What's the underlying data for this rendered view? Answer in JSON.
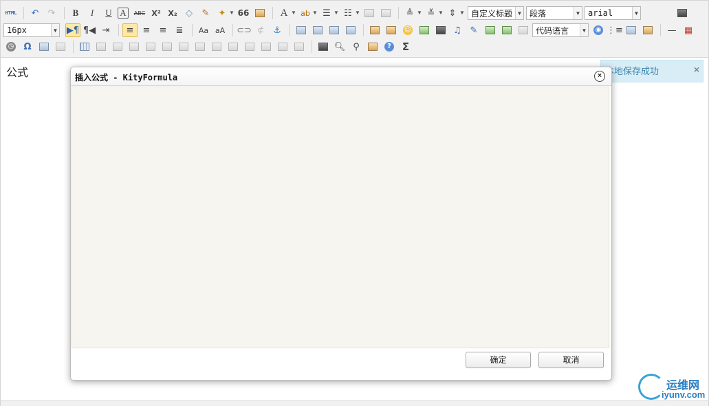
{
  "toolbar": {
    "row1": {
      "html_label": "HTML",
      "bold": "B",
      "italic": "I",
      "underline": "U",
      "fontborder": "A",
      "strikethrough": "ABC",
      "superscript": "X²",
      "subscript": "X₂",
      "quote": "66",
      "forecolor": "A",
      "backcolor": "ab",
      "custom_heading": "自定义标题",
      "paragraph": "段落",
      "font_family": "arial"
    },
    "row2": {
      "font_size": "16px",
      "code_language": "代码语言"
    },
    "row3": {
      "special_char": "Ω",
      "formula": "Σ"
    }
  },
  "content": {
    "text": "公式"
  },
  "notification": {
    "text": "本地保存成功",
    "close": "×"
  },
  "dialog": {
    "title": "插入公式 - KityFormula",
    "close": "×",
    "ok_label": "确定",
    "cancel_label": "取消"
  },
  "watermark": {
    "cn": "运维网",
    "en": "iyunv.com"
  }
}
